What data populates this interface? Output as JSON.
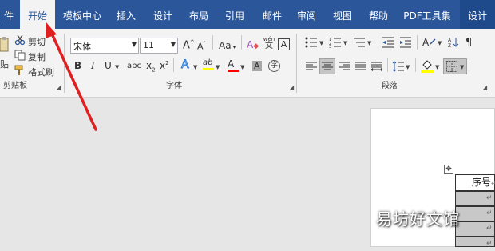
{
  "menu": [
    {
      "label": "件"
    },
    {
      "label": "开始"
    },
    {
      "label": "模板中心"
    },
    {
      "label": "插入"
    },
    {
      "label": "设计"
    },
    {
      "label": "布局"
    },
    {
      "label": "引用"
    },
    {
      "label": "邮件"
    },
    {
      "label": "审阅"
    },
    {
      "label": "视图"
    },
    {
      "label": "帮助"
    },
    {
      "label": "PDF工具集"
    },
    {
      "label": "设计"
    }
  ],
  "clipboard": {
    "paste_partial": "贴",
    "cut": "剪切",
    "copy": "复制",
    "format_painter": "格式刷",
    "group_title": "剪贴板"
  },
  "font": {
    "family": "宋体",
    "size": "11",
    "group_title": "字体",
    "grow": "A",
    "shrink": "A",
    "change_case": "Aa",
    "clear_format": "A",
    "phonetic_top": "wén",
    "phonetic_bottom": "文",
    "char_border": "A",
    "bold": "B",
    "italic": "I",
    "underline": "U",
    "strike": "abc",
    "subscript": "x",
    "superscript": "x",
    "sub_mark": "2",
    "sup_mark": "2",
    "text_effect": "A",
    "highlight": "ab",
    "font_color": "A",
    "char_shading": "A",
    "enclosed": "字"
  },
  "paragraph": {
    "group_title": "段落"
  },
  "colors": {
    "ribbon_blue": "#2b579a",
    "highlight_yellow": "#ffff00",
    "font_red": "#ff0000",
    "shading_yellow": "#ffff00"
  },
  "document": {
    "move_handle": "✥",
    "table_header": "序号",
    "row_mark": "↵",
    "watermark": "易坊好文馆"
  }
}
